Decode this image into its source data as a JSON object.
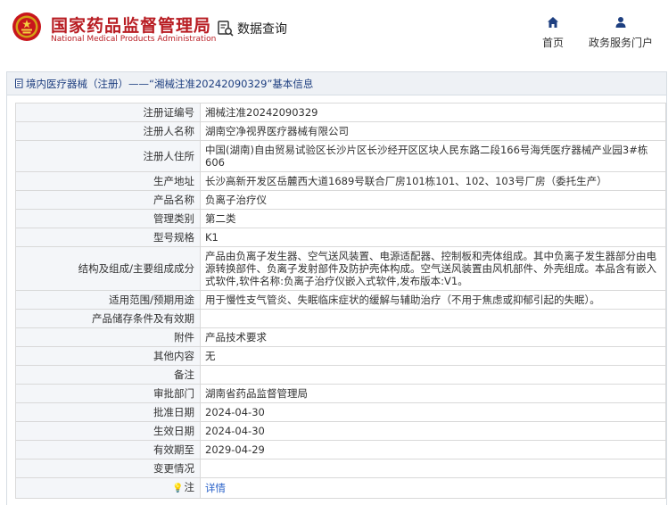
{
  "header": {
    "brand_cn": "国家药品监督管理局",
    "brand_en": "National Medical Products Administration",
    "query_label": "数据查询",
    "nav": {
      "home": "首页",
      "gov": "政务服务门户"
    },
    "brand_color": "#b81c22"
  },
  "breadcrumb": {
    "text": "境内医疗器械（注册）——“湘械注准20242090329”基本信息"
  },
  "rows": [
    {
      "label": "注册证编号",
      "value": "湘械注准20242090329"
    },
    {
      "label": "注册人名称",
      "value": "湖南空净视界医疗器械有限公司"
    },
    {
      "label": "注册人住所",
      "value": "中国(湖南)自由贸易试验区长沙片区长沙经开区区块人民东路二段166号海凭医疗器械产业园3#栋606"
    },
    {
      "label": "生产地址",
      "value": "长沙高新开发区岳麓西大道1689号联合厂房101栋101、102、103号厂房（委托生产）"
    },
    {
      "label": "产品名称",
      "value": "负离子治疗仪"
    },
    {
      "label": "管理类别",
      "value": "第二类"
    },
    {
      "label": "型号规格",
      "value": "K1"
    },
    {
      "label": "结构及组成/主要组成成分",
      "value": "产品由负离子发生器、空气送风装置、电源适配器、控制板和壳体组成。其中负离子发生器部分由电源转换部件、负离子发射部件及防护壳体构成。空气送风装置由风机部件、外壳组成。本品含有嵌入式软件,软件名称:负离子治疗仪嵌入式软件,发布版本:V1。"
    },
    {
      "label": "适用范围/预期用途",
      "value": "用于慢性支气管炎、失眠临床症状的缓解与辅助治疗（不用于焦虑或抑郁引起的失眠）。"
    },
    {
      "label": "产品储存条件及有效期",
      "value": ""
    },
    {
      "label": "附件",
      "value": "产品技术要求"
    },
    {
      "label": "其他内容",
      "value": "无"
    },
    {
      "label": "备注",
      "value": ""
    },
    {
      "label": "审批部门",
      "value": "湖南省药品监督管理局"
    },
    {
      "label": "批准日期",
      "value": "2024-04-30"
    },
    {
      "label": "生效日期",
      "value": "2024-04-30"
    },
    {
      "label": "有效期至",
      "value": "2029-04-29"
    },
    {
      "label": "变更情况",
      "value": ""
    },
    {
      "label": "注",
      "value": "详情"
    }
  ]
}
